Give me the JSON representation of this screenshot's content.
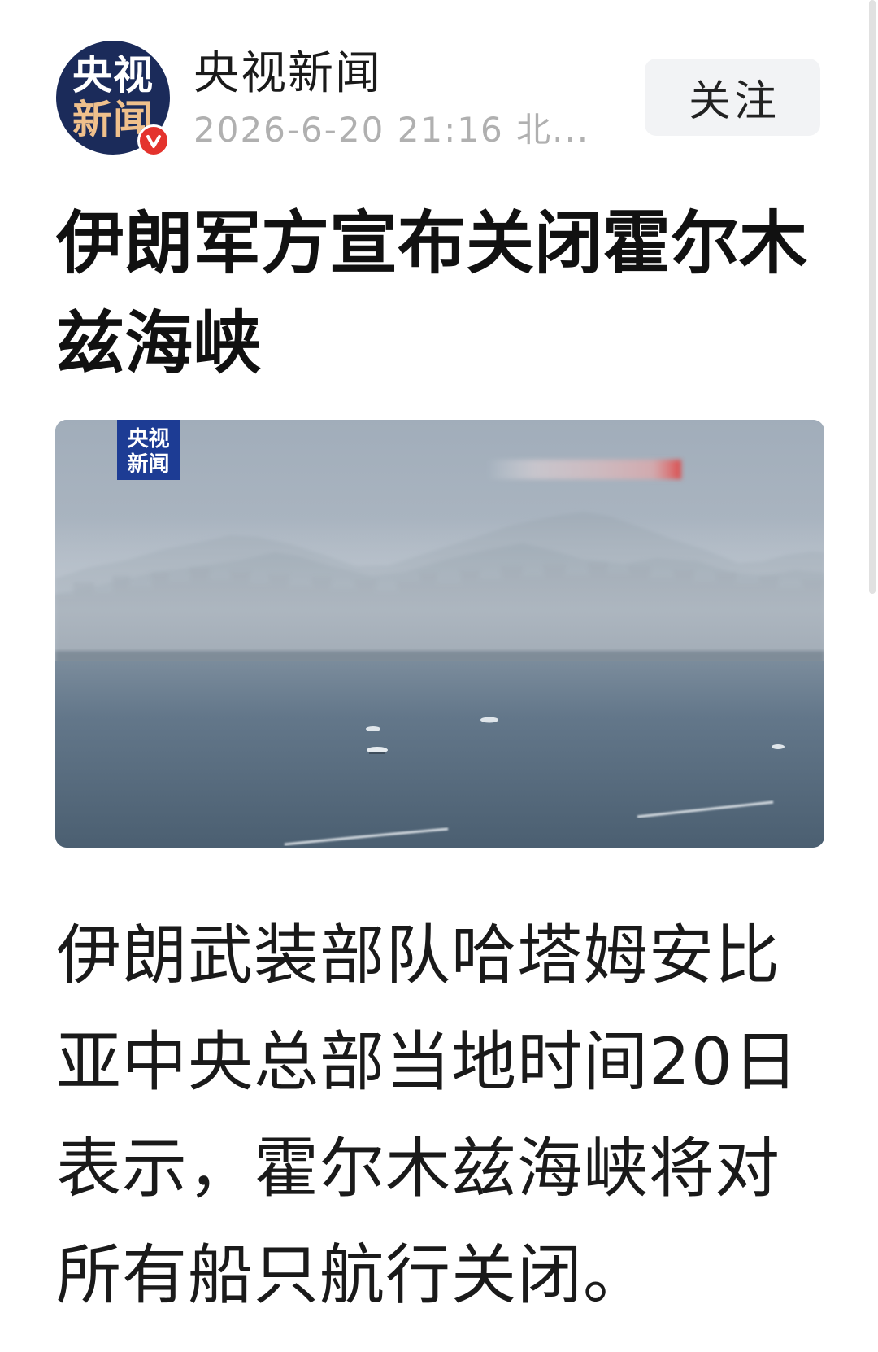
{
  "header": {
    "avatar_logo_lines": [
      "央视",
      "新闻"
    ],
    "account_name": "央视新闻",
    "timestamp": "2026-6-20 21:16 北...",
    "follow_label": "关注"
  },
  "article": {
    "headline_lines": [
      "伊朗军方宣布关闭霍尔木",
      "兹海峡"
    ],
    "body_lines": [
      "伊朗武装部队哈塔姆安比",
      "亚中央总部当地时间20日",
      "表示，霍尔木兹海峡将对",
      "所有船只航行关闭。"
    ]
  },
  "media": {
    "watermark_logo_lines": [
      "央视",
      "新闻"
    ]
  },
  "icons": {
    "verified_badge": "verified-badge-icon"
  },
  "colors": {
    "avatar_bg": "#1b2b5a",
    "avatar_accent": "#efc08c",
    "badge_red": "#e4332d",
    "follow_bg": "#f2f3f5",
    "text_main": "#1a1a1a",
    "text_muted": "#b0b0b0",
    "logo_bg": "#1d3c94"
  }
}
